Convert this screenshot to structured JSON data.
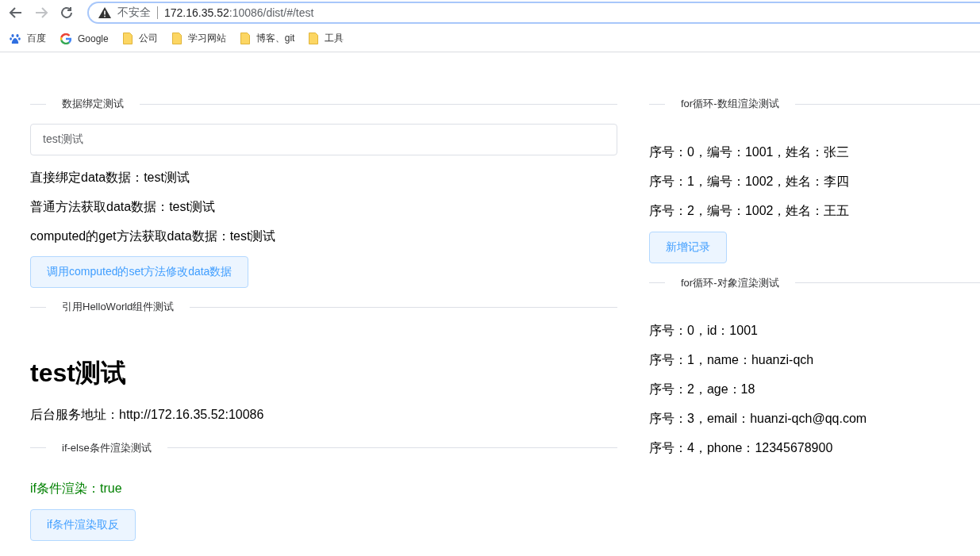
{
  "browser": {
    "nav": [
      {
        "kind": "back",
        "disabled": false
      },
      {
        "kind": "forward",
        "disabled": true
      },
      {
        "kind": "reload",
        "disabled": false
      }
    ],
    "security": "不安全",
    "url_host": "172.16.35.52",
    "url_rest": ":10086/dist/#/test",
    "bookmarks": [
      {
        "kind": "baidu",
        "label": "百度"
      },
      {
        "kind": "google",
        "label": "Google"
      },
      {
        "kind": "folder",
        "label": "公司"
      },
      {
        "kind": "folder",
        "label": "学习网站"
      },
      {
        "kind": "folder",
        "label": "博客、git"
      },
      {
        "kind": "folder",
        "label": "工具"
      }
    ]
  },
  "left": [
    {
      "kind": "divider",
      "text": "数据绑定测试"
    },
    {
      "kind": "input",
      "value": "test测试"
    },
    {
      "kind": "text",
      "text": "直接绑定data数据：test测试"
    },
    {
      "kind": "text",
      "text": "普通方法获取data数据：test测试"
    },
    {
      "kind": "text",
      "text": "computed的get方法获取data数据：test测试"
    },
    {
      "kind": "button",
      "text": "调用computed的set方法修改data数据"
    },
    {
      "kind": "divider",
      "text": "引用HelloWorld组件测试"
    },
    {
      "kind": "heading",
      "text": "test测试"
    },
    {
      "kind": "text",
      "text": "后台服务地址：http://172.16.35.52:10086"
    },
    {
      "kind": "divider",
      "text": "if-else条件渲染测试"
    },
    {
      "kind": "text",
      "text": "if条件渲染：true",
      "color": "#008000"
    },
    {
      "kind": "button",
      "text": "if条件渲染取反"
    }
  ],
  "right": [
    {
      "kind": "divider",
      "text": "for循环-数组渲染测试"
    },
    {
      "kind": "text",
      "text": "序号：0，编号：1001，姓名：张三"
    },
    {
      "kind": "text",
      "text": "序号：1，编号：1002，姓名：李四"
    },
    {
      "kind": "text",
      "text": "序号：2，编号：1002，姓名：王五"
    },
    {
      "kind": "button",
      "text": "新增记录"
    },
    {
      "kind": "divider",
      "text": "for循环-对象渲染测试"
    },
    {
      "kind": "text",
      "text": "序号：0，id：1001"
    },
    {
      "kind": "text",
      "text": "序号：1，name：huanzi-qch"
    },
    {
      "kind": "text",
      "text": "序号：2，age：18"
    },
    {
      "kind": "text",
      "text": "序号：3，email：huanzi-qch@qq.com"
    },
    {
      "kind": "text",
      "text": "序号：4，phone：12345678900"
    }
  ]
}
